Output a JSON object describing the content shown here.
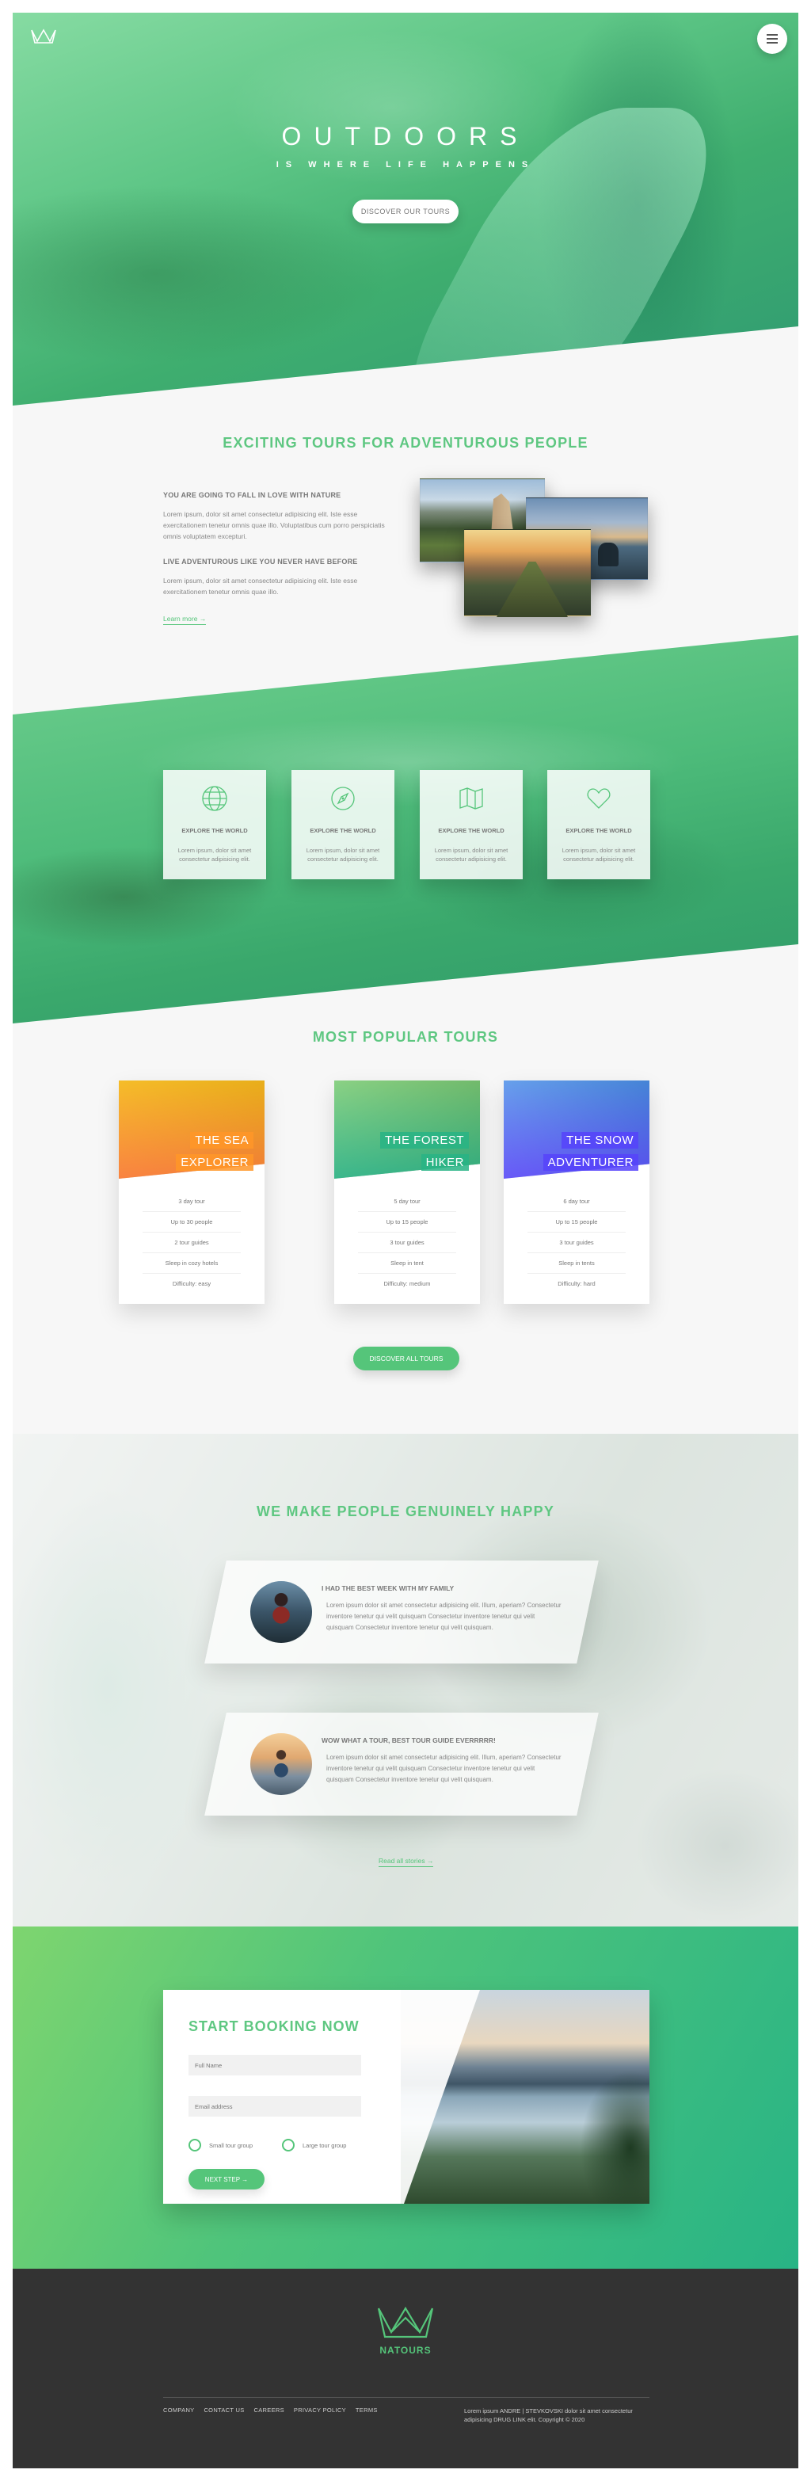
{
  "header": {
    "title": "OUTDOORS",
    "subtitle": "IS WHERE LIFE HAPPENS",
    "cta": "DISCOVER OUR TOURS"
  },
  "about": {
    "title": "EXCITING TOURS FOR ADVENTUROUS PEOPLE",
    "heading_1": "YOU ARE GOING TO FALL IN LOVE WITH NATURE",
    "paragraph_1": "Lorem ipsum, dolor sit amet consectetur adipisicing elit. Iste esse exercitationem tenetur omnis quae illo. Voluptatibus cum porro perspiciatis omnis voluptatem excepturi.",
    "heading_2": "LIVE ADVENTUROUS LIKE YOU NEVER HAVE BEFORE",
    "paragraph_2": "Lorem ipsum, dolor sit amet consectetur adipisicing elit. Iste esse exercitationem tenetur omnis quae illo.",
    "link": "Learn more →"
  },
  "features": [
    {
      "icon": "globe-icon",
      "title": "EXPLORE THE WORLD",
      "text": "Lorem ipsum, dolor sit amet consectetur adipisicing elit."
    },
    {
      "icon": "compass-icon",
      "title": "EXPLORE THE WORLD",
      "text": "Lorem ipsum, dolor sit amet consectetur adipisicing elit."
    },
    {
      "icon": "map-icon",
      "title": "EXPLORE THE WORLD",
      "text": "Lorem ipsum, dolor sit amet consectetur adipisicing elit."
    },
    {
      "icon": "heart-icon",
      "title": "EXPLORE THE WORLD",
      "text": "Lorem ipsum, dolor sit amet consectetur adipisicing elit."
    }
  ],
  "tours": {
    "title": "MOST POPULAR TOURS",
    "cards": [
      {
        "name_1": "THE SEA",
        "name_2": "EXPLORER",
        "details": [
          "3 day tour",
          "Up to 30 people",
          "2 tour guides",
          "Sleep in cozy hotels",
          "Difficulty: easy"
        ]
      },
      {
        "name_1": "THE FOREST",
        "name_2": "HIKER",
        "details": [
          "5 day tour",
          "Up to 15 people",
          "3 tour guides",
          "Sleep in tent",
          "Difficulty: medium"
        ]
      },
      {
        "name_1": "THE SNOW",
        "name_2": "ADVENTURER",
        "details": [
          "6 day tour",
          "Up to 15 people",
          "3 tour guides",
          "Sleep in tents",
          "Difficulty: hard"
        ]
      }
    ],
    "cta": "DISCOVER ALL TOURS"
  },
  "stories": {
    "title": "WE MAKE PEOPLE GENUINELY HAPPY",
    "items": [
      {
        "heading": "I HAD THE BEST WEEK WITH MY FAMILY",
        "text": "Lorem ipsum dolor sit amet consectetur adipisicing elit. Illum, aperiam? Consectetur inventore tenetur qui velit quisquam Consectetur inventore tenetur qui velit quisquam Consectetur inventore tenetur qui velit quisquam."
      },
      {
        "heading": "WOW WHAT A TOUR, BEST TOUR GUIDE EVERRRRR!",
        "text": "Lorem ipsum dolor sit amet consectetur adipisicing elit. Illum, aperiam? Consectetur inventore tenetur qui velit quisquam Consectetur inventore tenetur qui velit quisquam Consectetur inventore tenetur qui velit quisquam."
      }
    ],
    "link": "Read all stories →"
  },
  "booking": {
    "title": "START BOOKING NOW",
    "name_placeholder": "Full Name",
    "email_placeholder": "Email address",
    "radio_small": "Small tour group",
    "radio_large": "Large tour group",
    "submit": "NEXT STEP →"
  },
  "footer": {
    "brand": "NATOURS",
    "nav": [
      "COMPANY",
      "CONTACT US",
      "CAREERS",
      "PRIVACY POLICY",
      "TERMS"
    ],
    "copyright": "Lorem ipsum ANDRE | STEVKOVSKI dolor sit amet consectetur adipisicing DRUG LINK elit. Copyright © 2020"
  },
  "colors": {
    "accent": "#55c57a",
    "footer": "#333333",
    "background": "#f7f7f7"
  }
}
